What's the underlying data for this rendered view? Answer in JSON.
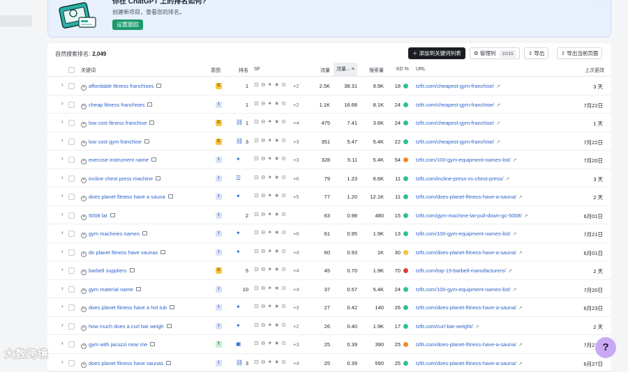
{
  "banner": {
    "title": "你在 ChatGPT 上的排名如何?",
    "subtitle": "创建新项目，查看您的排名。",
    "button": "设置跟踪",
    "close_icon": "close-icon"
  },
  "toolbar": {
    "organic_label": "自然搜索排名:",
    "organic_count": "2,049",
    "add_to_list": "添加到关键词列表",
    "manage_columns": "管理列",
    "columns_count": "10/15",
    "export": "导出",
    "export_page": "导出当前页面"
  },
  "columns": {
    "keyword": "关键词",
    "intent": "意图",
    "position": "排名",
    "sf": "SF",
    "traffic": "流量",
    "traffic_share": "流量...",
    "volume": "搜索量",
    "kd": "KD %",
    "url": "URL",
    "updated": "上次更改"
  },
  "colors": {
    "link": "#2a62c9",
    "kd_green": "#2fc38a",
    "kd_orange": "#f08a24",
    "kd_red": "#e03b3b",
    "intent_commercial": "#f6c641",
    "intent_informational": "#d9e3f7",
    "intent_transactional": "#c9efd5"
  },
  "rows": [
    {
      "keyword": "affordable fitness franchises",
      "intent": "C",
      "pos_icon": "",
      "position": "1",
      "sf_more": "+2",
      "traffic": "2.5K",
      "share": "38.31",
      "volume": "9.9K",
      "kd": "18",
      "kd_color": "#2fc38a",
      "url": "tzfit.com/cheapest-gym-franchise/",
      "updated": "3 天"
    },
    {
      "keyword": "cheap fitness franchises",
      "intent": "I",
      "pos_icon": "",
      "position": "1",
      "sf_more": "+2",
      "traffic": "1.1K",
      "share": "16.68",
      "volume": "8.1K",
      "kd": "24",
      "kd_color": "#2fc38a",
      "url": "tzfit.com/cheapest-gym-franchise/",
      "updated": "7月22日"
    },
    {
      "keyword": "low cost fitness franchise",
      "intent": "C",
      "pos_icon": "link-icon",
      "position": "1",
      "sf_more": "+4",
      "traffic": "475",
      "share": "7.41",
      "volume": "3.6K",
      "kd": "24",
      "kd_color": "#2fc38a",
      "url": "tzfit.com/cheapest-gym-franchise/",
      "updated": "1 天"
    },
    {
      "keyword": "low cost gym franchise",
      "intent": "C",
      "pos_icon": "link-icon",
      "position": "3",
      "sf_more": "+3",
      "traffic": "351",
      "share": "5.47",
      "volume": "5.4K",
      "kd": "22",
      "kd_color": "#2fc38a",
      "url": "tzfit.com/cheapest-gym-franchise/",
      "updated": "7月22日"
    },
    {
      "keyword": "exercise instrument name",
      "intent": "I",
      "pos_icon": "sparkle-icon",
      "position": "",
      "sf_more": "+3",
      "traffic": "328",
      "share": "5.11",
      "volume": "5.4K",
      "kd": "54",
      "kd_color": "#f08a24",
      "url": "tzfit.com/100-gym-equipment-names-list/",
      "updated": "7月20日"
    },
    {
      "keyword": "incline chest press machine",
      "intent": "I",
      "pos_icon": "list-icon",
      "position": "",
      "sf_more": "+6",
      "traffic": "79",
      "share": "1.23",
      "volume": "6.6K",
      "kd": "11",
      "kd_color": "#2fc38a",
      "url": "tzfit.com/incline-press-vs-chest-press/",
      "updated": "3 天"
    },
    {
      "keyword": "does planet fitness have a sauna",
      "intent": "I",
      "pos_icon": "sparkle-icon",
      "position": "",
      "sf_more": "+5",
      "traffic": "77",
      "share": "1.20",
      "volume": "12.1K",
      "kd": "11",
      "kd_color": "#2fc38a",
      "url": "tzfit.com/does-planet-fitness-have-a-sauna/",
      "updated": "2 天"
    },
    {
      "keyword": "5008 lat",
      "intent": "I",
      "pos_icon": "",
      "position": "2",
      "sf_more": "",
      "traffic": "63",
      "share": "0.98",
      "volume": "480",
      "kd": "15",
      "kd_color": "#2fc38a",
      "url": "tzfit.com/gym-machine-lat-pull-down-gc-5008/",
      "updated": "6月01日"
    },
    {
      "keyword": "gym machines names",
      "intent": "I",
      "pos_icon": "sparkle-icon",
      "position": "",
      "sf_more": "+6",
      "traffic": "61",
      "share": "0.95",
      "volume": "1.9K",
      "kd": "13",
      "kd_color": "#2fc38a",
      "url": "tzfit.com/100-gym-equipment-names-list/",
      "updated": "7月21日"
    },
    {
      "keyword": "do planet fitness have saunas",
      "intent": "I",
      "pos_icon": "sparkle-icon",
      "position": "",
      "sf_more": "+4",
      "traffic": "60",
      "share": "0.93",
      "volume": "1K",
      "kd": "30",
      "kd_color": "#f0c43a",
      "url": "tzfit.com/does-planet-fitness-have-a-sauna/",
      "updated": "6月01日"
    },
    {
      "keyword": "barbell suppliers",
      "intent": "C",
      "pos_icon": "",
      "position": "5",
      "sf_more": "+4",
      "traffic": "45",
      "share": "0.70",
      "volume": "1.9K",
      "kd": "70",
      "kd_color": "#e03b3b",
      "url": "tzfit.com/top-15-barbell-manufacturers/",
      "updated": "2 天"
    },
    {
      "keyword": "gym material name",
      "intent": "I",
      "pos_icon": "",
      "position": "10",
      "sf_more": "+4",
      "traffic": "37",
      "share": "0.57",
      "volume": "5.4K",
      "kd": "24",
      "kd_color": "#2fc38a",
      "url": "tzfit.com/100-gym-equipment-names-list/",
      "updated": "7月20日"
    },
    {
      "keyword": "does planet fitness have a hot tub",
      "intent": "I",
      "pos_icon": "sparkle-icon",
      "position": "",
      "sf_more": "+3",
      "traffic": "27",
      "share": "0.42",
      "volume": "140",
      "kd": "26",
      "kd_color": "#2fc38a",
      "url": "tzfit.com/does-planet-fitness-have-a-sauna/",
      "updated": "6月23日"
    },
    {
      "keyword": "how much does a curl bar weigh",
      "intent": "I",
      "pos_icon": "sparkle-icon",
      "position": "",
      "sf_more": "+2",
      "traffic": "26",
      "share": "0.40",
      "volume": "1.9K",
      "kd": "17",
      "kd_color": "#2fc38a",
      "url": "tzfit.com/curl-bar-weight/",
      "updated": "2 天"
    },
    {
      "keyword": "gym with jacuzzi near me",
      "intent": "T",
      "pos_icon": "chat-icon",
      "position": "",
      "sf_more": "+3",
      "traffic": "25",
      "share": "0.39",
      "volume": "390",
      "kd": "25",
      "kd_color": "#f08a24",
      "url": "tzfit.com/does-planet-fitness-have-a-sauna/",
      "updated": "7月21日"
    },
    {
      "keyword": "does planet fitness have saunas",
      "intent": "I",
      "pos_icon": "link-icon",
      "position": "3",
      "sf_more": "+4",
      "traffic": "25",
      "share": "0.39",
      "volume": "590",
      "kd": "25",
      "kd_color": "#2fc38a",
      "url": "tzfit.com/does-planet-fitness-have-a-sauna/",
      "updated": "6月27日"
    }
  ],
  "watermark": "大数跨境",
  "help": "?"
}
